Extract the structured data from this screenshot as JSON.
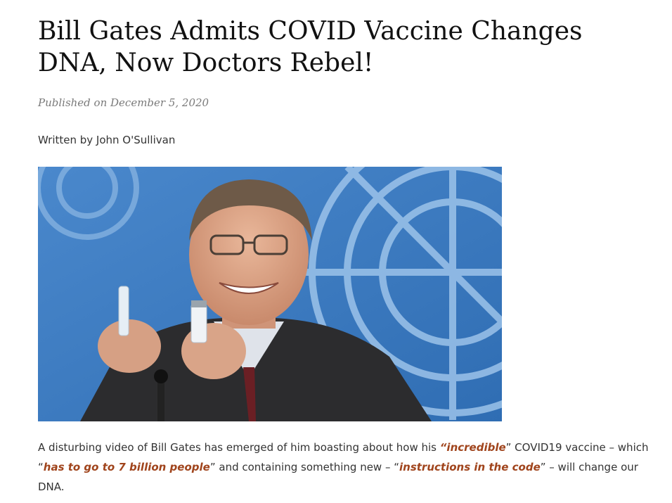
{
  "article": {
    "title": "Bill Gates Admits COVID Vaccine Changes DNA, Now Doctors Rebel!",
    "published": "Published on December 5, 2020",
    "byline": "Written by John O'Sullivan",
    "body": {
      "t1": "A disturbing video of Bill Gates has emerged of him boasting about how his ",
      "q1": "“incredible",
      "t2": "” COVID19 vaccine – which “",
      "q2": "has to go to 7 billion people",
      "t3": "” and containing something new – “",
      "q3": "instructions in the code",
      "t4": "” – will change our DNA."
    }
  },
  "colors": {
    "quote_accent": "#a0441c",
    "photo_background": "#3f7fc4"
  }
}
